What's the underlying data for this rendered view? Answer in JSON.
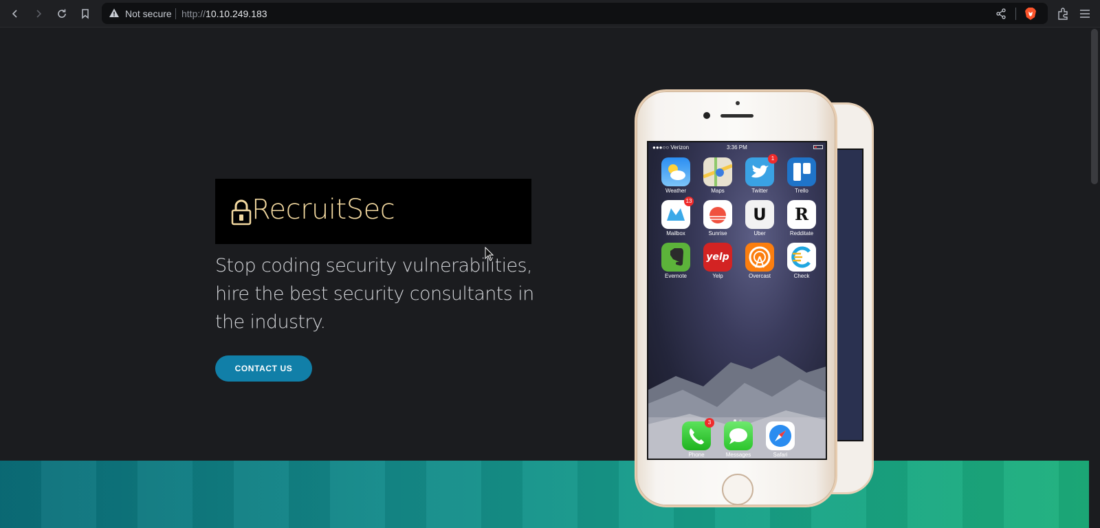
{
  "browser": {
    "not_secure_label": "Not secure",
    "url_scheme": "http://",
    "url_host": "10.10.249.183"
  },
  "hero": {
    "brand": "RecruitSec",
    "tagline": "Stop coding security vulnerabilities, hire the best security consultants in the industry.",
    "cta_label": "CONTACT US"
  },
  "phone": {
    "status": {
      "carrier": "●●●○○ Verizon",
      "time": "3:36 PM"
    },
    "apps": [
      {
        "name": "Weather",
        "badge": ""
      },
      {
        "name": "Maps",
        "badge": ""
      },
      {
        "name": "Twitter",
        "badge": "1"
      },
      {
        "name": "Trello",
        "badge": ""
      },
      {
        "name": "Mailbox",
        "badge": "13"
      },
      {
        "name": "Sunrise",
        "badge": ""
      },
      {
        "name": "Uber",
        "badge": ""
      },
      {
        "name": "Redditate",
        "badge": ""
      },
      {
        "name": "Evernote",
        "badge": ""
      },
      {
        "name": "Yelp",
        "badge": ""
      },
      {
        "name": "Overcast",
        "badge": ""
      },
      {
        "name": "Check",
        "badge": ""
      }
    ],
    "dock": [
      {
        "name": "Phone",
        "badge": "3"
      },
      {
        "name": "Messages",
        "badge": ""
      },
      {
        "name": "Safari",
        "badge": ""
      }
    ],
    "yelp_text": "yelp",
    "redditate_letter": "R",
    "uber_letter": "U"
  },
  "colors": {
    "background": "#1b1c1f",
    "brand_gold": "#f3d9a0",
    "cta_blue": "#117fa8",
    "band_teal": "#148a8a"
  },
  "icons": [
    "back-icon",
    "forward-icon",
    "reload-icon",
    "bookmark-icon",
    "warning-icon",
    "share-icon",
    "brave-lion-icon",
    "extensions-icon",
    "menu-icon",
    "lock-icon"
  ]
}
